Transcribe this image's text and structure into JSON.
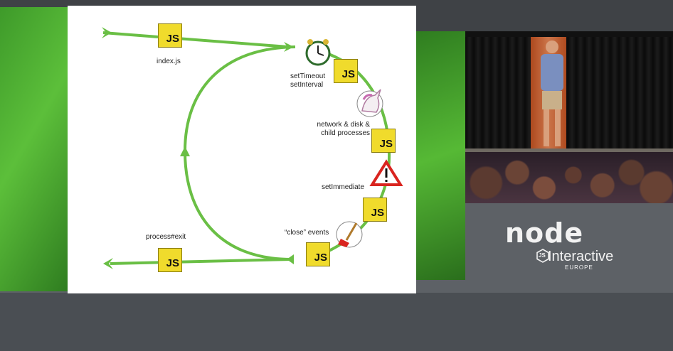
{
  "slide": {
    "labels": {
      "index": "index.js",
      "timers": "setTimeout\nsetInterval",
      "network": "network & disk &\nchild processes",
      "immediate": "setImmediate",
      "close": "“close” events",
      "exit": "process#exit"
    },
    "js_badge": "JS",
    "icons": [
      "clock-icon",
      "unicorn-icon",
      "warning-icon",
      "broom-icon"
    ]
  },
  "logo": {
    "name": "node",
    "js": "JS",
    "product": "Interactive",
    "region": "EUROPE"
  },
  "colors": {
    "arrow_green": "#6abf45",
    "badge_yellow": "#f0db2c"
  }
}
